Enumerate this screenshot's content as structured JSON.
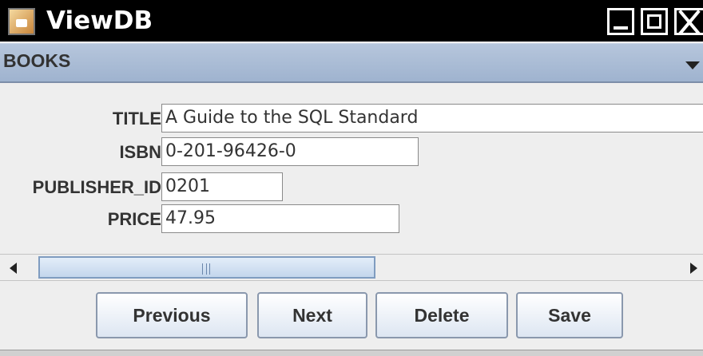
{
  "window": {
    "title": "ViewDB"
  },
  "table_selector": {
    "selected": "BOOKS"
  },
  "form": {
    "fields": [
      {
        "label": "TITLE",
        "value": "A Guide to the SQL Standard"
      },
      {
        "label": "ISBN",
        "value": "0-201-96426-0"
      },
      {
        "label": "PUBLISHER_ID",
        "value": "0201"
      },
      {
        "label": "PRICE",
        "value": "47.95"
      }
    ]
  },
  "buttons": {
    "previous": "Previous",
    "next": "Next",
    "delete": "Delete",
    "save": "Save"
  },
  "icons": {
    "app": "java-app-icon",
    "minimize": "minimize-icon",
    "maximize": "maximize-icon",
    "close": "close-icon",
    "dropdown": "chevron-down-icon"
  }
}
